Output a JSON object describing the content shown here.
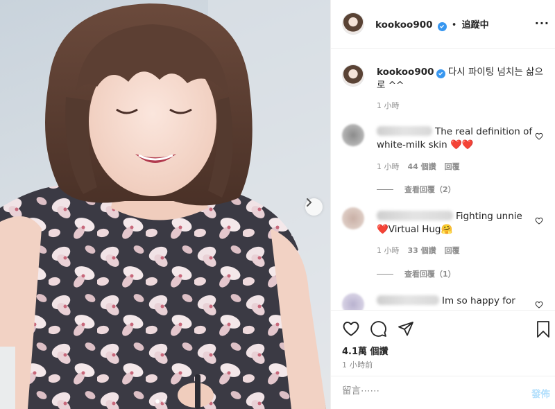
{
  "header": {
    "username": "kookoo900",
    "separator": "•",
    "follow_status": "追蹤中",
    "more": "···"
  },
  "caption": {
    "username": "kookoo900",
    "text": "다시 파이팅 넘치는 삶으로 ^^",
    "time": "1 小時"
  },
  "comments": [
    {
      "text": "The real definition of white-milk skin ❤️❤️",
      "time": "1 小時",
      "likes": "44 個讚",
      "reply": "回覆",
      "view_replies": "查看回覆（2）"
    },
    {
      "text": "Fighting unnie ❤️Virtual Hug🤗",
      "time": "1 小時",
      "likes": "33 個讚",
      "reply": "回覆",
      "view_replies": "查看回覆（1）"
    },
    {
      "text": "Im so happy for you"
    }
  ],
  "stats": {
    "views": "4.1萬 個讚",
    "posted": "1 小時前"
  },
  "comment_box": {
    "placeholder": "留言⋯⋯",
    "post": "發佈"
  },
  "icons": {
    "heart": "heart-icon",
    "comment": "comment-icon",
    "share": "share-icon",
    "save": "bookmark-icon",
    "next": "chevron-right-icon"
  },
  "colors": {
    "verified": "#3897f0",
    "post_button": "#b2dffc",
    "muted": "#8e8e8e"
  }
}
